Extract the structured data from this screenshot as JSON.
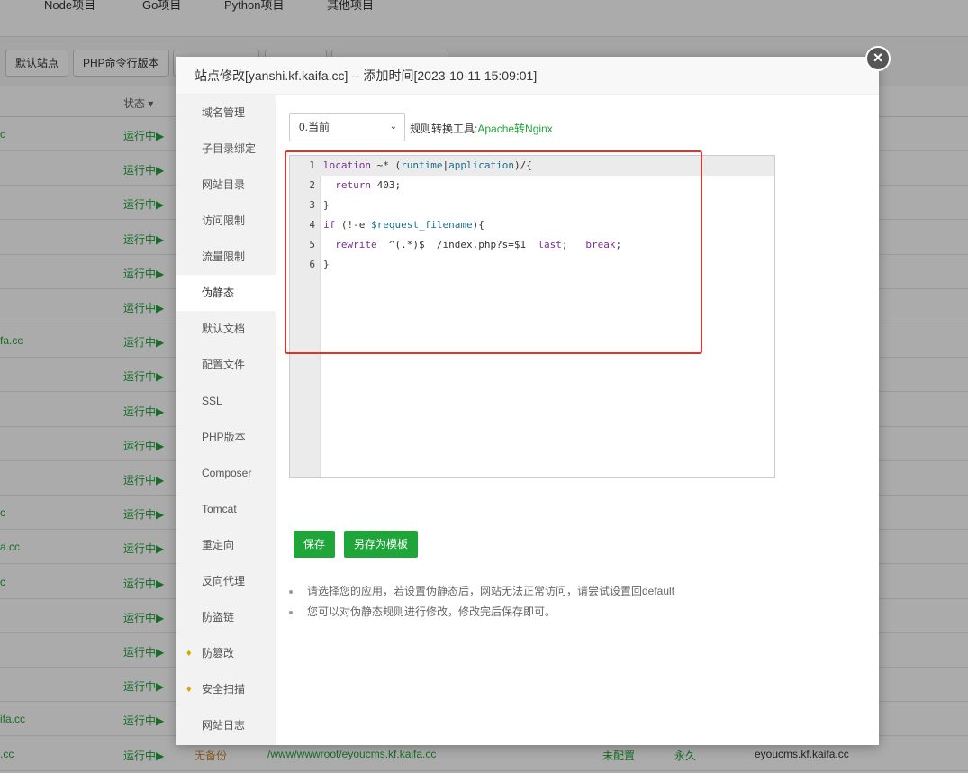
{
  "topnav": [
    "Node项目",
    "Go项目",
    "Python项目",
    "其他项目"
  ],
  "toolbar": {
    "default_site": "默认站点",
    "php_cli": "PHP命令行版本"
  },
  "table": {
    "status_header": "状态",
    "rows": [
      {
        "domain": "c",
        "status": "运行中▶"
      },
      {
        "domain": "",
        "status": "运行中▶"
      },
      {
        "domain": "",
        "status": "运行中▶"
      },
      {
        "domain": "",
        "status": "运行中▶"
      },
      {
        "domain": "",
        "status": "运行中▶"
      },
      {
        "domain": "",
        "status": "运行中▶"
      },
      {
        "domain": "fa.cc",
        "status": "运行中▶"
      },
      {
        "domain": "",
        "status": "运行中▶"
      },
      {
        "domain": "",
        "status": "运行中▶"
      },
      {
        "domain": "",
        "status": "运行中▶"
      },
      {
        "domain": "",
        "status": "运行中▶"
      },
      {
        "domain": "c",
        "status": "运行中▶"
      },
      {
        "domain": "a.cc",
        "status": "运行中▶"
      },
      {
        "domain": "c",
        "status": "运行中▶"
      },
      {
        "domain": "",
        "status": "运行中▶"
      },
      {
        "domain": "",
        "status": "运行中▶"
      },
      {
        "domain": "",
        "status": "运行中▶"
      },
      {
        "domain": "ifa.cc",
        "status": "运行中▶"
      },
      {
        "domain": ".cc",
        "status": "运行中▶",
        "backup": "无备份",
        "path": "/www/wwwroot/eyoucms.kf.kaifa.cc",
        "ssl": "未配置",
        "expire": "永久",
        "remark": "eyoucms.kf.kaifa.cc"
      }
    ]
  },
  "modal": {
    "title": "站点修改[yanshi.kf.kaifa.cc] -- 添加时间[2023-10-11 15:09:01]",
    "close": "×",
    "sidebar": [
      {
        "label": "域名管理"
      },
      {
        "label": "子目录绑定"
      },
      {
        "label": "网站目录"
      },
      {
        "label": "访问限制"
      },
      {
        "label": "流量限制"
      },
      {
        "label": "伪静态",
        "active": true
      },
      {
        "label": "默认文档"
      },
      {
        "label": "配置文件"
      },
      {
        "label": "SSL"
      },
      {
        "label": "PHP版本"
      },
      {
        "label": "Composer"
      },
      {
        "label": "Tomcat"
      },
      {
        "label": "重定向"
      },
      {
        "label": "反向代理"
      },
      {
        "label": "防盗链"
      },
      {
        "label": "防篡改",
        "icon": "gem-icon"
      },
      {
        "label": "安全扫描",
        "icon": "gem-icon"
      },
      {
        "label": "网站日志"
      }
    ],
    "template_select": "0.当前",
    "converter_label": "规则转换工具:",
    "converter_link": "Apache转Nginx",
    "code_lines": [
      "location ~* (runtime|application)/{",
      "  return 403;",
      "}",
      "if (!-e $request_filename){",
      "  rewrite  ^(.*)$  /index.php?s=$1  last;   break;",
      "}"
    ],
    "save": "保存",
    "save_template": "另存为模板",
    "tips": [
      "请选择您的应用，若设置伪静态后，网站无法正常访问，请尝试设置回default",
      "您可以对伪静态规则进行修改，修改完后保存即可。"
    ]
  },
  "colors": {
    "accent": "#20a53a",
    "highlight_box": "#e8302b"
  }
}
